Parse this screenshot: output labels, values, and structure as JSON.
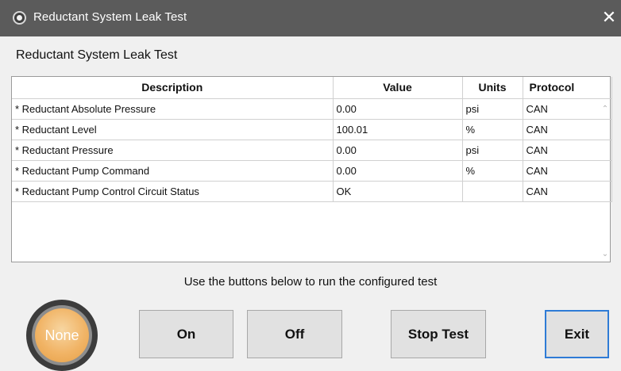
{
  "window": {
    "title": "Reductant System Leak Test",
    "close_glyph": "✕",
    "icon": "app-icon"
  },
  "header": {
    "label": "Reductant System Leak Test"
  },
  "table": {
    "columns": [
      "Description",
      "Value",
      "Units",
      "Protocol"
    ],
    "rows": [
      {
        "description": "* Reductant Absolute Pressure",
        "value": "0.00",
        "units": "psi",
        "protocol": "CAN"
      },
      {
        "description": "* Reductant Level",
        "value": "100.01",
        "units": "%",
        "protocol": "CAN"
      },
      {
        "description": "* Reductant Pressure",
        "value": "0.00",
        "units": "psi",
        "protocol": "CAN"
      },
      {
        "description": "* Reductant Pump Command",
        "value": "0.00",
        "units": "%",
        "protocol": "CAN"
      },
      {
        "description": "* Reductant Pump Control Circuit Status",
        "value": "OK",
        "units": "",
        "protocol": "CAN"
      }
    ],
    "scroll_up_glyph": "⌃",
    "scroll_down_glyph": "⌄"
  },
  "footer": {
    "instruction": "Use the buttons below to run the configured test",
    "status_indicator": "None",
    "status_color": "#f1b466",
    "buttons": {
      "on": "On",
      "off": "Off",
      "stop": "Stop Test",
      "exit": "Exit"
    }
  }
}
